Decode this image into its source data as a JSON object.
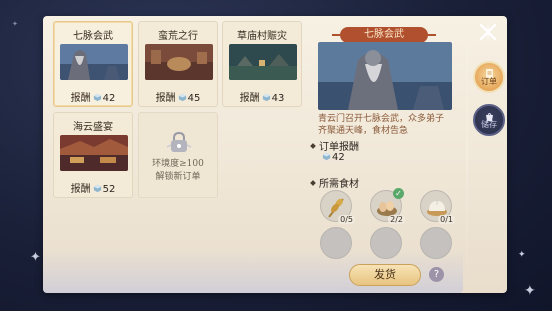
{
  "orders": [
    {
      "title": "七脉会武",
      "reward_label": "报酬",
      "reward_qty": "42",
      "selected": true
    },
    {
      "title": "蛮荒之行",
      "reward_label": "报酬",
      "reward_qty": "45"
    },
    {
      "title": "草庙村赈灾",
      "reward_label": "报酬",
      "reward_qty": "43"
    },
    {
      "title": "海云盛宴",
      "reward_label": "报酬",
      "reward_qty": "52"
    }
  ],
  "locked_order": {
    "line1": "环境度≥100",
    "line2": "解锁新订单"
  },
  "detail": {
    "title": "七脉会武",
    "description": "青云门召开七脉会武，众多弟子齐聚通天峰，食材告急",
    "order_reward_title": "订单报酬",
    "order_reward_qty": "42",
    "ingredients_title": "所需食材",
    "ingredients": [
      {
        "name": "wheat-icon",
        "count": "0/5"
      },
      {
        "name": "eggs-icon",
        "count": "2/2",
        "complete": true
      },
      {
        "name": "steamed-bun-icon",
        "count": "0/1"
      }
    ]
  },
  "deliver_button": "发货",
  "help_button": "?",
  "side_tabs": [
    {
      "label": "订单",
      "active": true
    },
    {
      "label": "储存",
      "active": false
    }
  ],
  "colors": {
    "banner": "#b0502f",
    "description_text": "#8a5a3a",
    "deliver_button": "#e8c47f",
    "active_tab": "#e6a75a",
    "check": "#5aa86a"
  }
}
